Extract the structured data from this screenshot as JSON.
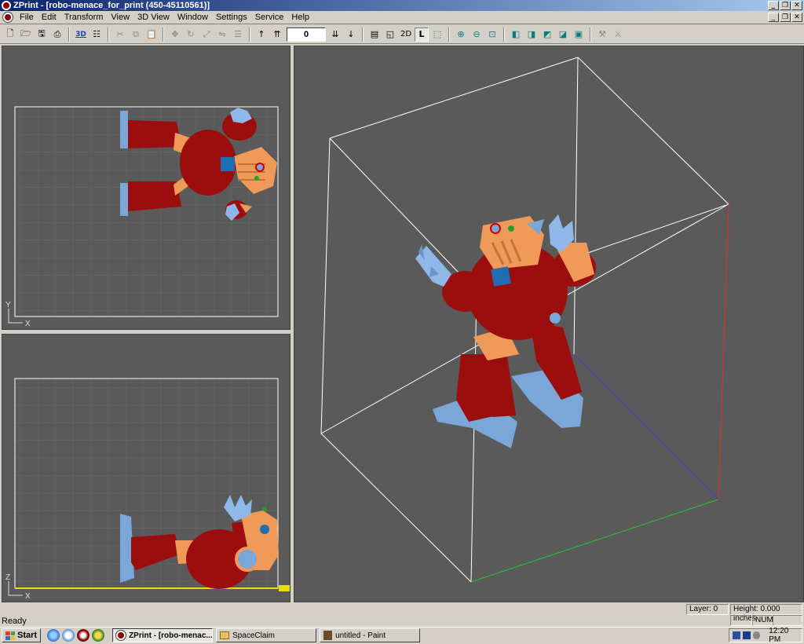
{
  "window": {
    "title": "ZPrint - [robo-menace_for_print (450-45110561)]"
  },
  "menu": [
    "File",
    "Edit",
    "Transform",
    "View",
    "3D View",
    "Window",
    "Settings",
    "Service",
    "Help"
  ],
  "toolbar": {
    "layer_value": "0",
    "view_2d_label": "2D",
    "view_l_label": "L",
    "view_3d_label": "3D"
  },
  "viewports": {
    "top": {
      "axis_v": "Y",
      "axis_h": "X"
    },
    "side": {
      "axis_v": "Z",
      "axis_h": "X"
    }
  },
  "status": {
    "ready": "Ready",
    "layer": "Layer: 0",
    "height": "Height: 0.000 inches",
    "num": "NUM"
  },
  "taskbar": {
    "start": "Start",
    "tasks": [
      "ZPrint - [robo-menac...",
      "SpaceClaim",
      "untitled - Paint"
    ],
    "clock": "12:20 PM"
  },
  "colors": {
    "model_red": "#9c0e0e",
    "model_orange": "#f09a5a",
    "model_blue": "#7aa6d8",
    "viewport_bg": "#5a5a5a",
    "axis_x": "#2fbf2f",
    "axis_y": "#3f3fdf",
    "axis_z": "#df2f2f"
  }
}
